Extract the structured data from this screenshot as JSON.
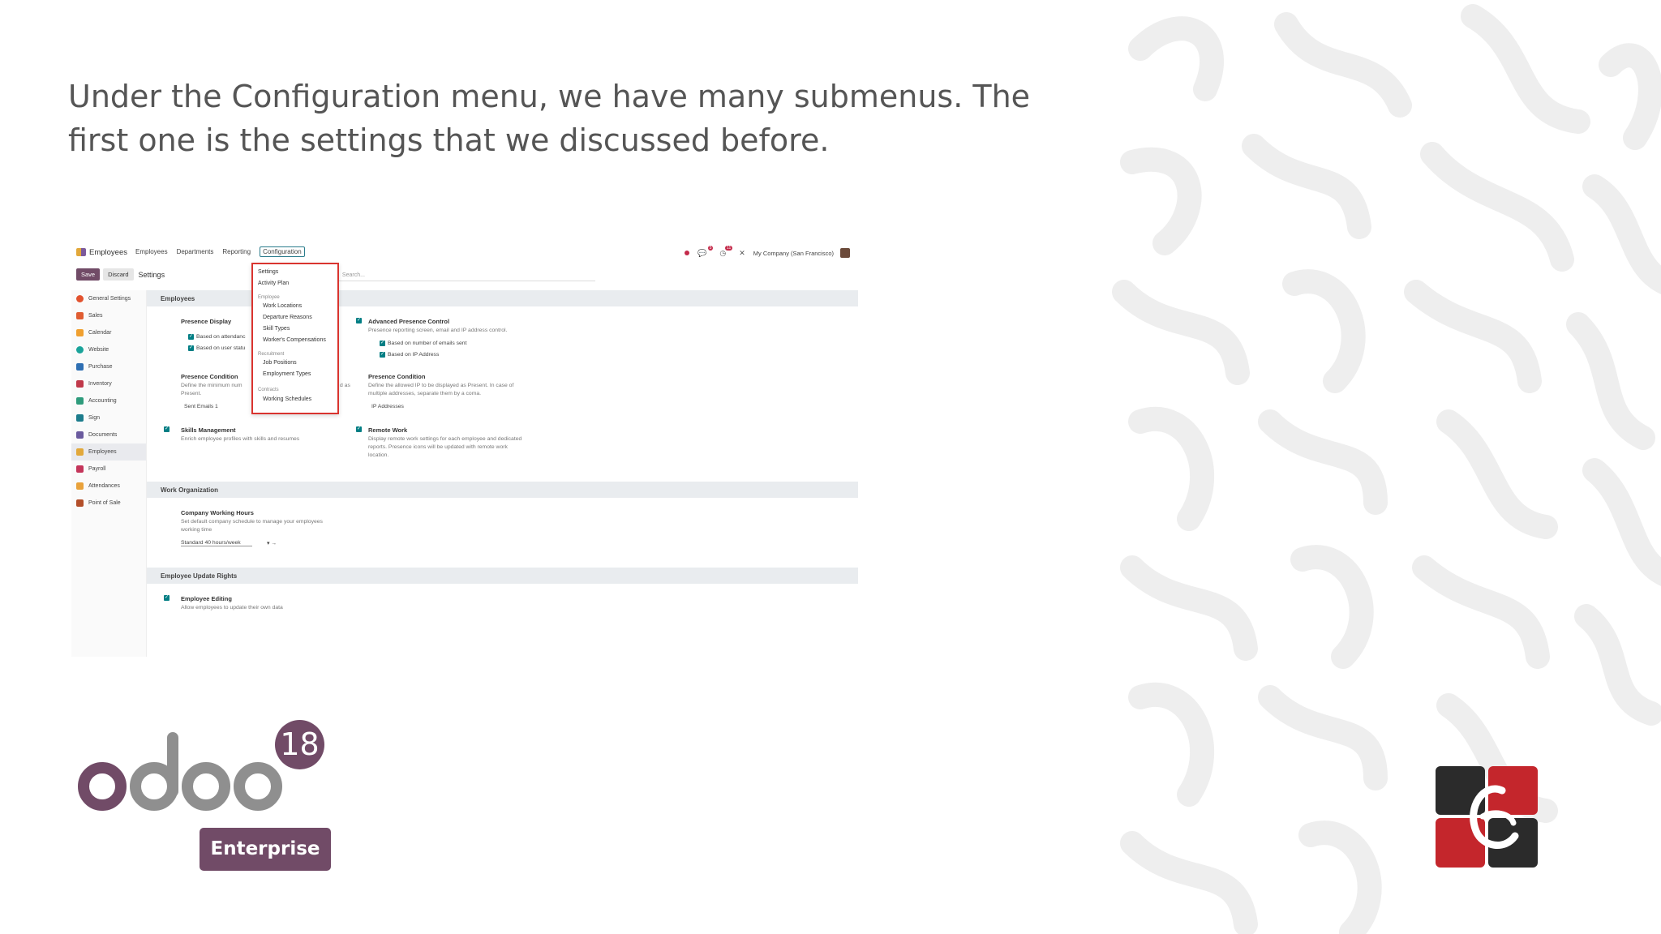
{
  "slide": {
    "caption": "Under the Configuration menu, we have many submenus. The first one is the settings that we discussed before.",
    "version_badge": "18",
    "edition_label": "Enterprise",
    "logo_text": "odoo"
  },
  "app": {
    "name": "Employees",
    "nav": [
      "Employees",
      "Departments",
      "Reporting",
      "Configuration"
    ],
    "company": "My Company (San Francisco)",
    "chat_badge": "5",
    "activity_badge": "11"
  },
  "actions": {
    "save": "Save",
    "discard": "Discard",
    "breadcrumb": "Settings",
    "search_placeholder": "Search..."
  },
  "sidebar": [
    "General Settings",
    "Sales",
    "Calendar",
    "Website",
    "Purchase",
    "Inventory",
    "Accounting",
    "Sign",
    "Documents",
    "Employees",
    "Payroll",
    "Attendances",
    "Point of Sale"
  ],
  "config_menu": {
    "settings": "Settings",
    "activity_plan": "Activity Plan",
    "employee_head": "Employee",
    "work_locations": "Work Locations",
    "departure_reasons": "Departure Reasons",
    "skill_types": "Skill Types",
    "workers_comp": "Worker's Compensations",
    "recruitment_head": "Recruitment",
    "job_positions": "Job Positions",
    "employment_types": "Employment Types",
    "contracts_head": "Contracts",
    "working_schedules": "Working Schedules"
  },
  "settings": {
    "sec_employees": "Employees",
    "presence_display": "Presence Display",
    "based_attendance": "Based on attendanc",
    "based_user_status": "Based on user statu",
    "presence_condition": "Presence Condition",
    "presence_condition_desc": "Define the minimum num",
    "present_word": "Present.",
    "as_fragment": "d as",
    "sent_emails": "Sent Emails",
    "sent_emails_value": "1",
    "advanced_presence": "Advanced Presence Control",
    "advanced_presence_desc": "Presence reporting screen, email and IP address control.",
    "based_emails": "Based on number of emails sent",
    "based_ip": "Based on IP Address",
    "presence_condition2": "Presence Condition",
    "presence_condition2_desc_1": "Define the allowed IP to be displayed as Present. In case of",
    "presence_condition2_desc_2": "multiple addresses, separate them by a coma.",
    "ip_addresses": "IP Addresses",
    "skills": "Skills Management",
    "skills_desc": "Enrich employee profiles with skills and resumes",
    "remote": "Remote Work",
    "remote_desc_1": "Display remote work settings for each employee and dedicated",
    "remote_desc_2": "reports. Presence icons will be updated with remote work",
    "remote_desc_3": "location.",
    "sec_work_org": "Work Organization",
    "company_hours": "Company Working Hours",
    "company_hours_desc_1": "Set default company schedule to manage your employees",
    "company_hours_desc_2": "working time",
    "schedule_value": "Standard 40 hours/week",
    "sec_update_rights": "Employee Update Rights",
    "employee_editing": "Employee Editing",
    "employee_editing_desc": "Allow employees to update their own data"
  }
}
